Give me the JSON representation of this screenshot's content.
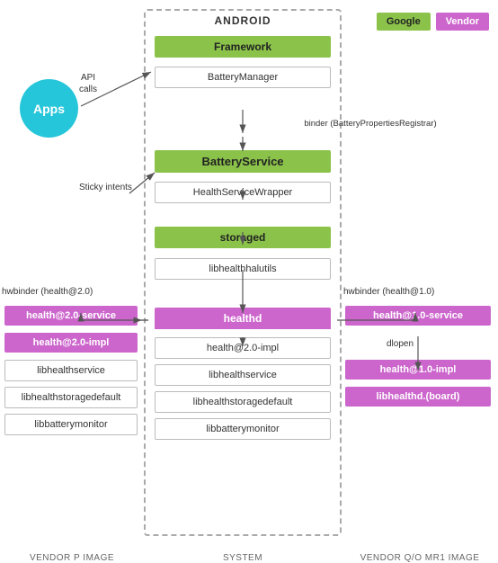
{
  "legend": {
    "google_label": "Google",
    "vendor_label": "Vendor"
  },
  "center_title": "ANDROID",
  "bottom_labels": {
    "left": "VENDOR P IMAGE",
    "center": "SYSTEM",
    "right": "VENDOR Q/O MR1 IMAGE"
  },
  "apps": {
    "label": "Apps",
    "api_calls": "API\ncalls"
  },
  "center_column": {
    "framework_label": "Framework",
    "battery_manager": "BatteryManager",
    "binder_label": "binder\n(BatteryPropertiesRegistrar)",
    "battery_service_label": "BatteryService",
    "health_service_wrapper": "HealthServiceWrapper",
    "storaged_label": "storaged",
    "libhealthhalutils": "libhealthhalutils",
    "healthd_label": "healthd",
    "health_impl_center": "health@2.0-impl",
    "libhealthservice_center": "libhealthservice",
    "libhealthstoragedefault_center": "libhealthstoragedefault",
    "libbatterymonitor_center": "libbatterymonitor"
  },
  "left_column": {
    "hwbinder_label": "hwbinder (health@2.0)",
    "service_label": "health@2.0-service",
    "impl_label": "health@2.0-impl",
    "libhealthservice": "libhealthservice",
    "libhealthstoragedefault": "libhealthstoragedefault",
    "libbatterymonitor": "libbatterymonitor"
  },
  "right_column": {
    "hwbinder_label": "hwbinder (health@1.0)",
    "service_label": "health@1.0-service",
    "dlopen_label": "dlopen",
    "impl_label": "health@1.0-impl",
    "libhealthd_board": "libhealthd.(board)"
  },
  "annotations": {
    "sticky_intents": "Sticky\nintents"
  }
}
